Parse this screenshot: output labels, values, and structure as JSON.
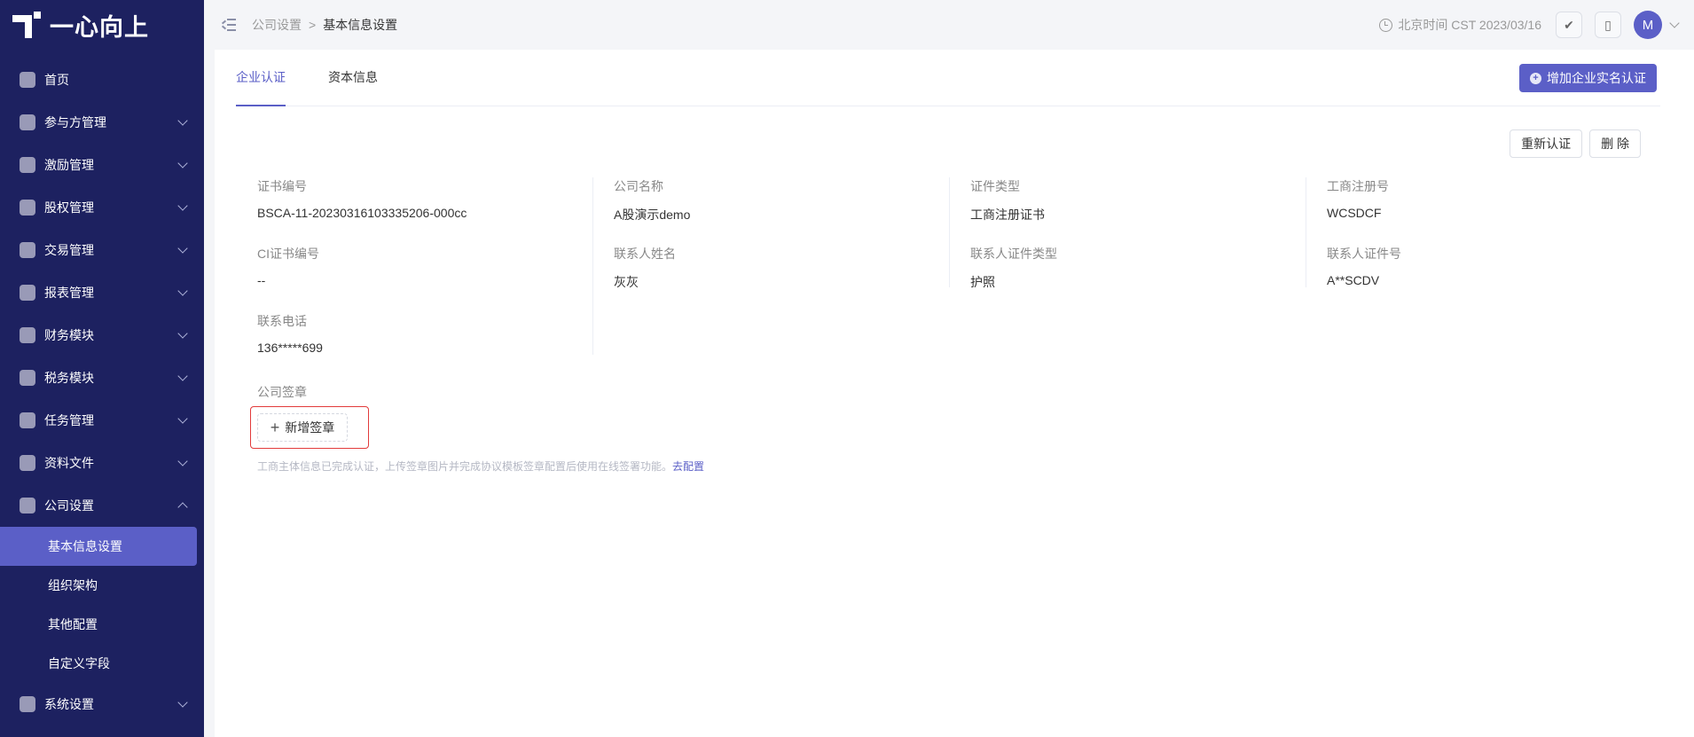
{
  "brand": {
    "logo_text": "一心向上"
  },
  "sidebar": {
    "items": [
      {
        "label": "首页",
        "icon": "home-icon",
        "expandable": false
      },
      {
        "label": "参与方管理",
        "icon": "participant-icon",
        "expandable": true
      },
      {
        "label": "激励管理",
        "icon": "incentive-icon",
        "expandable": true
      },
      {
        "label": "股权管理",
        "icon": "equity-icon",
        "expandable": true
      },
      {
        "label": "交易管理",
        "icon": "trade-icon",
        "expandable": true
      },
      {
        "label": "报表管理",
        "icon": "report-icon",
        "expandable": true
      },
      {
        "label": "财务模块",
        "icon": "finance-icon",
        "expandable": true
      },
      {
        "label": "税务模块",
        "icon": "tax-icon",
        "expandable": true
      },
      {
        "label": "任务管理",
        "icon": "task-icon",
        "expandable": true
      },
      {
        "label": "资料文件",
        "icon": "folder-icon",
        "expandable": true
      },
      {
        "label": "公司设置",
        "icon": "company-icon",
        "expandable": true,
        "expanded": true
      },
      {
        "label": "系统设置",
        "icon": "system-icon",
        "expandable": true
      }
    ],
    "company_sub": [
      {
        "label": "基本信息设置",
        "active": true
      },
      {
        "label": "组织架构"
      },
      {
        "label": "其他配置"
      },
      {
        "label": "自定义字段"
      }
    ]
  },
  "header": {
    "breadcrumb": [
      "公司设置",
      "基本信息设置"
    ],
    "breadcrumb_sep": ">",
    "time": "北京时间 CST 2023/03/16",
    "avatar_initial": "M"
  },
  "tabs": [
    {
      "label": "企业认证",
      "active": true
    },
    {
      "label": "资本信息",
      "active": false
    }
  ],
  "actions": {
    "add_verification": "增加企业实名认证",
    "reverify": "重新认证",
    "delete": "删 除"
  },
  "info": [
    {
      "label": "证书编号",
      "value": "BSCA-11-20230316103335206-000cc"
    },
    {
      "label": "公司名称",
      "value": "A股演示demo"
    },
    {
      "label": "证件类型",
      "value": "工商注册证书"
    },
    {
      "label": "工商注册号",
      "value": "WCSDCF"
    },
    {
      "label": "CI证书编号",
      "value": "--"
    },
    {
      "label": "联系人姓名",
      "value": "灰灰"
    },
    {
      "label": "联系人证件类型",
      "value": "护照"
    },
    {
      "label": "联系人证件号",
      "value": "A**SCDV"
    },
    {
      "label": "联系电话",
      "value": "136*****699"
    }
  ],
  "seal": {
    "label": "公司签章",
    "add_button": "新增签章",
    "hint": "工商主体信息已完成认证，上传签章图片并完成协议模板签章配置后使用在线签署功能。",
    "hint_link": "去配置"
  },
  "colors": {
    "sidebar_bg": "#1d2160",
    "accent": "#5b5fc7",
    "highlight_border": "#e23b3b"
  }
}
